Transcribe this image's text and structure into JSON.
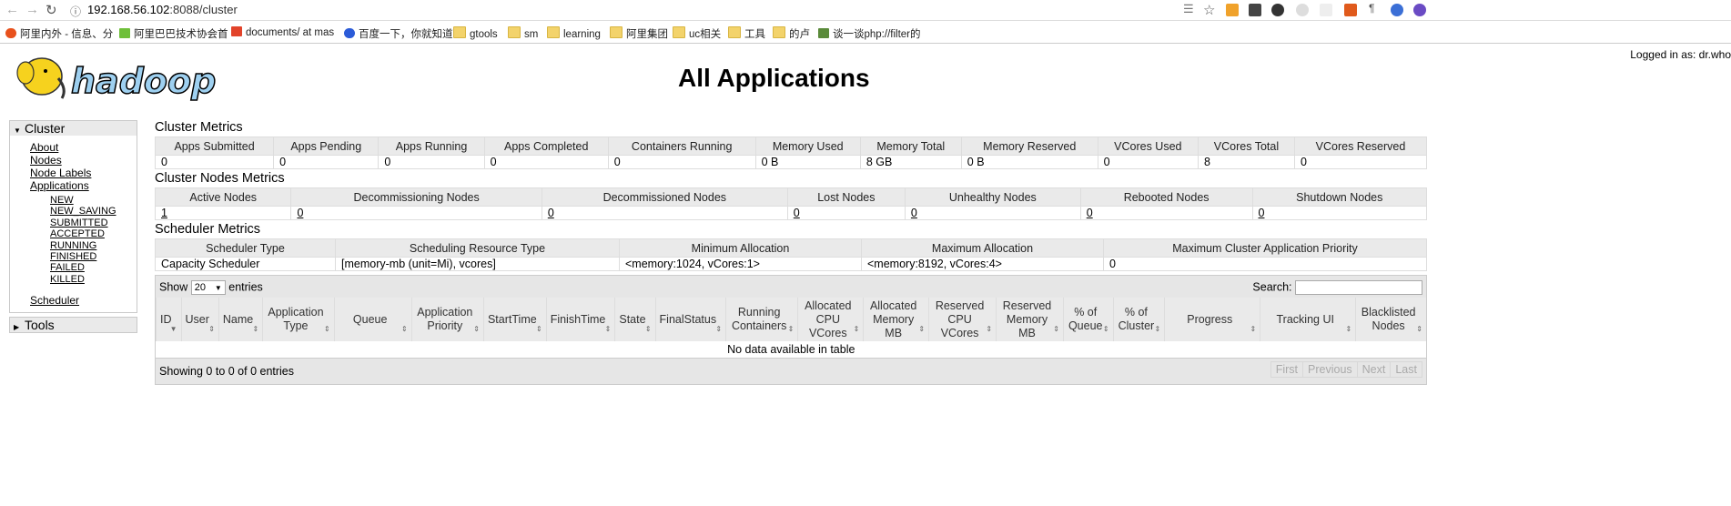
{
  "browser": {
    "url_host": "192.168.56.102",
    "url_path": ":8088/cluster",
    "bookmarks": [
      {
        "label": "阿里内外 - 信息、分",
        "icon": "star-icon"
      },
      {
        "label": "阿里巴巴技术协会首",
        "icon": "code-icon"
      },
      {
        "label": "documents/ at mas",
        "icon": "gitlab-icon"
      },
      {
        "label": "百度一下，你就知道",
        "icon": "paw-icon"
      },
      {
        "label": "gtools",
        "icon": "folder-icon"
      },
      {
        "label": "sm",
        "icon": "folder-icon"
      },
      {
        "label": "learning",
        "icon": "folder-icon"
      },
      {
        "label": "阿里集团",
        "icon": "folder-icon"
      },
      {
        "label": "uc相关",
        "icon": "folder-icon"
      },
      {
        "label": "工具",
        "icon": "folder-icon"
      },
      {
        "label": "的卢",
        "icon": "folder-icon"
      },
      {
        "label": "谈一谈php://filter的",
        "icon": "leaf-icon"
      }
    ]
  },
  "header": {
    "logo_text": "hadoop",
    "title": "All Applications",
    "logged_in": "Logged in as: dr.who"
  },
  "sidebar": {
    "cluster_label": "Cluster",
    "links": [
      "About",
      "Nodes",
      "Node Labels",
      "Applications"
    ],
    "states": [
      "NEW",
      "NEW_SAVING",
      "SUBMITTED",
      "ACCEPTED",
      "RUNNING",
      "FINISHED",
      "FAILED",
      "KILLED"
    ],
    "scheduler": "Scheduler",
    "tools_label": "Tools"
  },
  "cluster_metrics": {
    "title": "Cluster Metrics",
    "headers": [
      "Apps Submitted",
      "Apps Pending",
      "Apps Running",
      "Apps Completed",
      "Containers Running",
      "Memory Used",
      "Memory Total",
      "Memory Reserved",
      "VCores Used",
      "VCores Total",
      "VCores Reserved"
    ],
    "values": [
      "0",
      "0",
      "0",
      "0",
      "0",
      "0 B",
      "8 GB",
      "0 B",
      "0",
      "8",
      "0"
    ]
  },
  "node_metrics": {
    "title": "Cluster Nodes Metrics",
    "headers": [
      "Active Nodes",
      "Decommissioning Nodes",
      "Decommissioned Nodes",
      "Lost Nodes",
      "Unhealthy Nodes",
      "Rebooted Nodes",
      "Shutdown Nodes"
    ],
    "values": [
      "1",
      "0",
      "0",
      "0",
      "0",
      "0",
      "0"
    ]
  },
  "scheduler_metrics": {
    "title": "Scheduler Metrics",
    "headers": [
      "Scheduler Type",
      "Scheduling Resource Type",
      "Minimum Allocation",
      "Maximum Allocation",
      "Maximum Cluster Application Priority"
    ],
    "values": [
      "Capacity Scheduler",
      "[memory-mb (unit=Mi), vcores]",
      "<memory:1024, vCores:1>",
      "<memory:8192, vCores:4>",
      "0"
    ]
  },
  "apps_table": {
    "show_label": "Show",
    "entries_value": "20",
    "entries_label": "entries",
    "search_label": "Search:",
    "headers": [
      "ID",
      "User",
      "Name",
      "Application Type",
      "Queue",
      "Application Priority",
      "StartTime",
      "FinishTime",
      "State",
      "FinalStatus",
      "Running Containers",
      "Allocated CPU VCores",
      "Allocated Memory MB",
      "Reserved CPU VCores",
      "Reserved Memory MB",
      "% of Queue",
      "% of Cluster",
      "Progress",
      "Tracking UI",
      "Blacklisted Nodes"
    ],
    "empty_text": "No data available in table",
    "info": "Showing 0 to 0 of 0 entries",
    "pager": [
      "First",
      "Previous",
      "Next",
      "Last"
    ]
  }
}
